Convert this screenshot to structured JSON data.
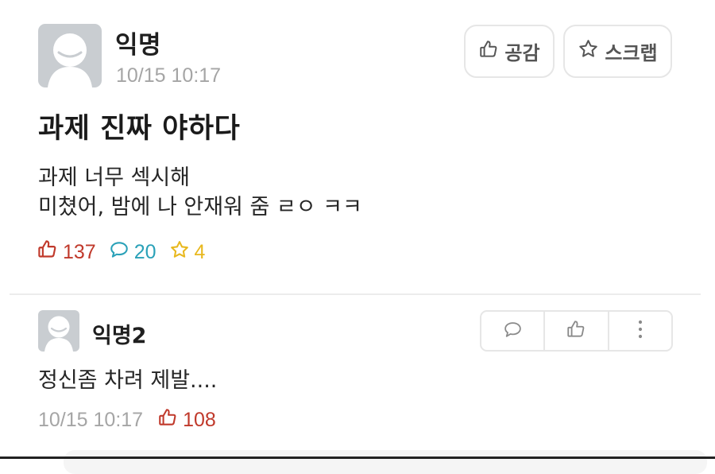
{
  "post": {
    "author": "익명",
    "time": "10/15 10:17",
    "title": "과제 진짜 야하다",
    "body_lines": [
      "과제 너무 섹시해",
      "미쳤어, 밤에 나 안재워 줌 ㄹㅇ ㅋㅋ"
    ],
    "buttons": {
      "like_label": "공감",
      "scrap_label": "스크랩"
    },
    "stats": {
      "likes": "137",
      "comments": "20",
      "scraps": "4"
    }
  },
  "comment": {
    "author": "익명2",
    "text": "정신좀 차려 제발....",
    "time": "10/15 10:17",
    "likes": "108"
  },
  "icons": {
    "like": "thumbs-up-icon",
    "scrap": "star-icon",
    "comment": "speech-bubble-icon",
    "more": "vertical-dots-icon",
    "avatar": "default-avatar-icon"
  },
  "colors": {
    "like_red": "#c0392b",
    "comment_teal": "#2aa1b8",
    "scrap_yellow": "#e8b81e",
    "muted_gray": "#a5a5a5"
  }
}
